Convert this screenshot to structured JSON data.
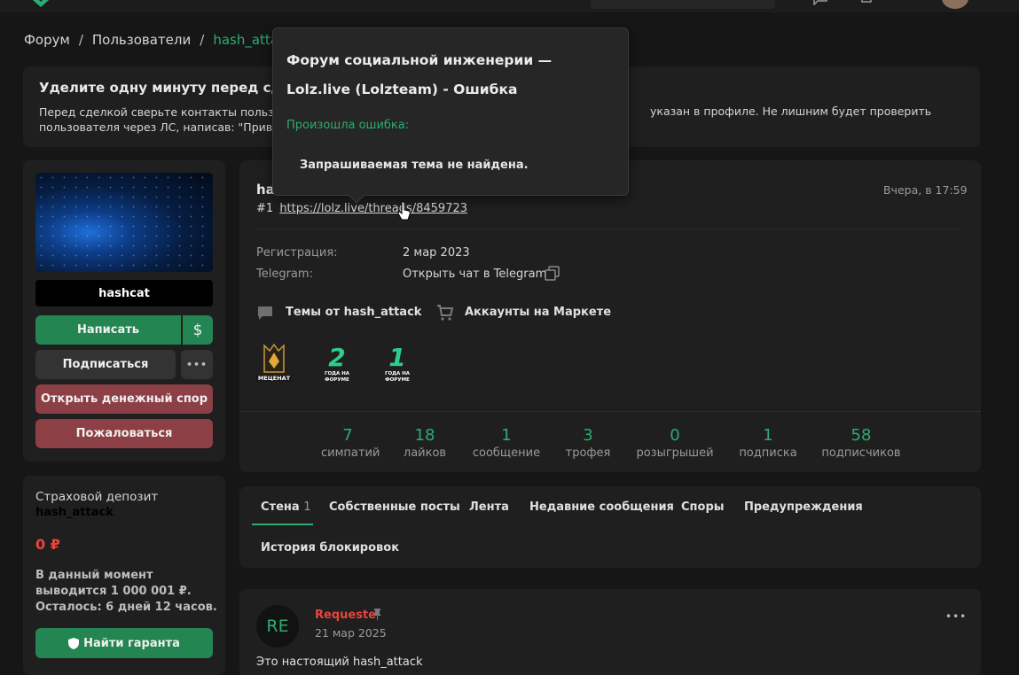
{
  "breadcrumb": {
    "items": [
      "Форум",
      "Пользователи",
      "hash_attack"
    ],
    "sep": "/"
  },
  "notice": {
    "title": "Уделите одну минуту перед сделкой",
    "text": "Перед сделкой сверьте контакты пользователя",
    "text_right": "указан в профиле. Не лишним будет проверить",
    "text_line2": "пользователя через ЛС, написав: \"Привет"
  },
  "profile": {
    "username": "hashcat",
    "buttons": {
      "write": "Написать",
      "money": "$",
      "subscribe": "Подписаться",
      "more": "•••",
      "dispute": "Открыть денежный спор",
      "report": "Пожаловаться"
    }
  },
  "header": {
    "name_partial": "ha",
    "post_number": "#1",
    "link": "https://lolz.live/threads/8459723",
    "time": "Вчера, в 17:59"
  },
  "info": {
    "registration_label": "Регистрация:",
    "registration_value": "2 мар 2023",
    "telegram_label": "Telegram:",
    "telegram_value": "Открыть чат в Telegram"
  },
  "links": {
    "topics": "Темы от hash_attack",
    "market": "Аккаунты на Маркете"
  },
  "badges": {
    "patron": "МЕЦЕНАТ",
    "years2_num": "2",
    "years1_num": "1",
    "years_caption_1": "ГОДА НА",
    "years_caption_2": "ФОРУМЕ"
  },
  "stats": [
    {
      "value": "7",
      "label": "симпатий"
    },
    {
      "value": "18",
      "label": "лайков"
    },
    {
      "value": "1",
      "label": "сообщение"
    },
    {
      "value": "3",
      "label": "трофея"
    },
    {
      "value": "0",
      "label": "розыгрышей"
    },
    {
      "value": "1",
      "label": "подписка"
    },
    {
      "value": "58",
      "label": "подписчиков"
    }
  ],
  "deposit": {
    "title": "Страховой депозит",
    "user": "hash_attack",
    "amount": "0 ₽",
    "line1": "В данный момент",
    "line2": "выводится 1 000 001 ₽.",
    "line3": "Осталось: 6 дней 12 часов.",
    "button": "Найти гаранта"
  },
  "tabs": {
    "wall": "Стена",
    "wall_count": "1",
    "own_posts": "Собственные посты",
    "feed": "Лента",
    "recent": "Недавние сообщения",
    "disputes": "Споры",
    "warnings": "Предупреждения",
    "bans": "История блокировок"
  },
  "post": {
    "avatar_text": "RE",
    "author": "Requeste",
    "date": "21 мар 2025",
    "text": "Это настоящий hash_attack",
    "menu": "•••"
  },
  "tooltip": {
    "title": "Форум социальной инженерии — Lolz.live (Lolzteam) - Ошибка",
    "error_label": "Произошла ошибка:",
    "message": "Запрашиваемая тема не найдена."
  },
  "colors": {
    "accent": "#2bad72",
    "danger": "#e8453c",
    "bg": "#161616",
    "panel": "#1f1f1f"
  }
}
